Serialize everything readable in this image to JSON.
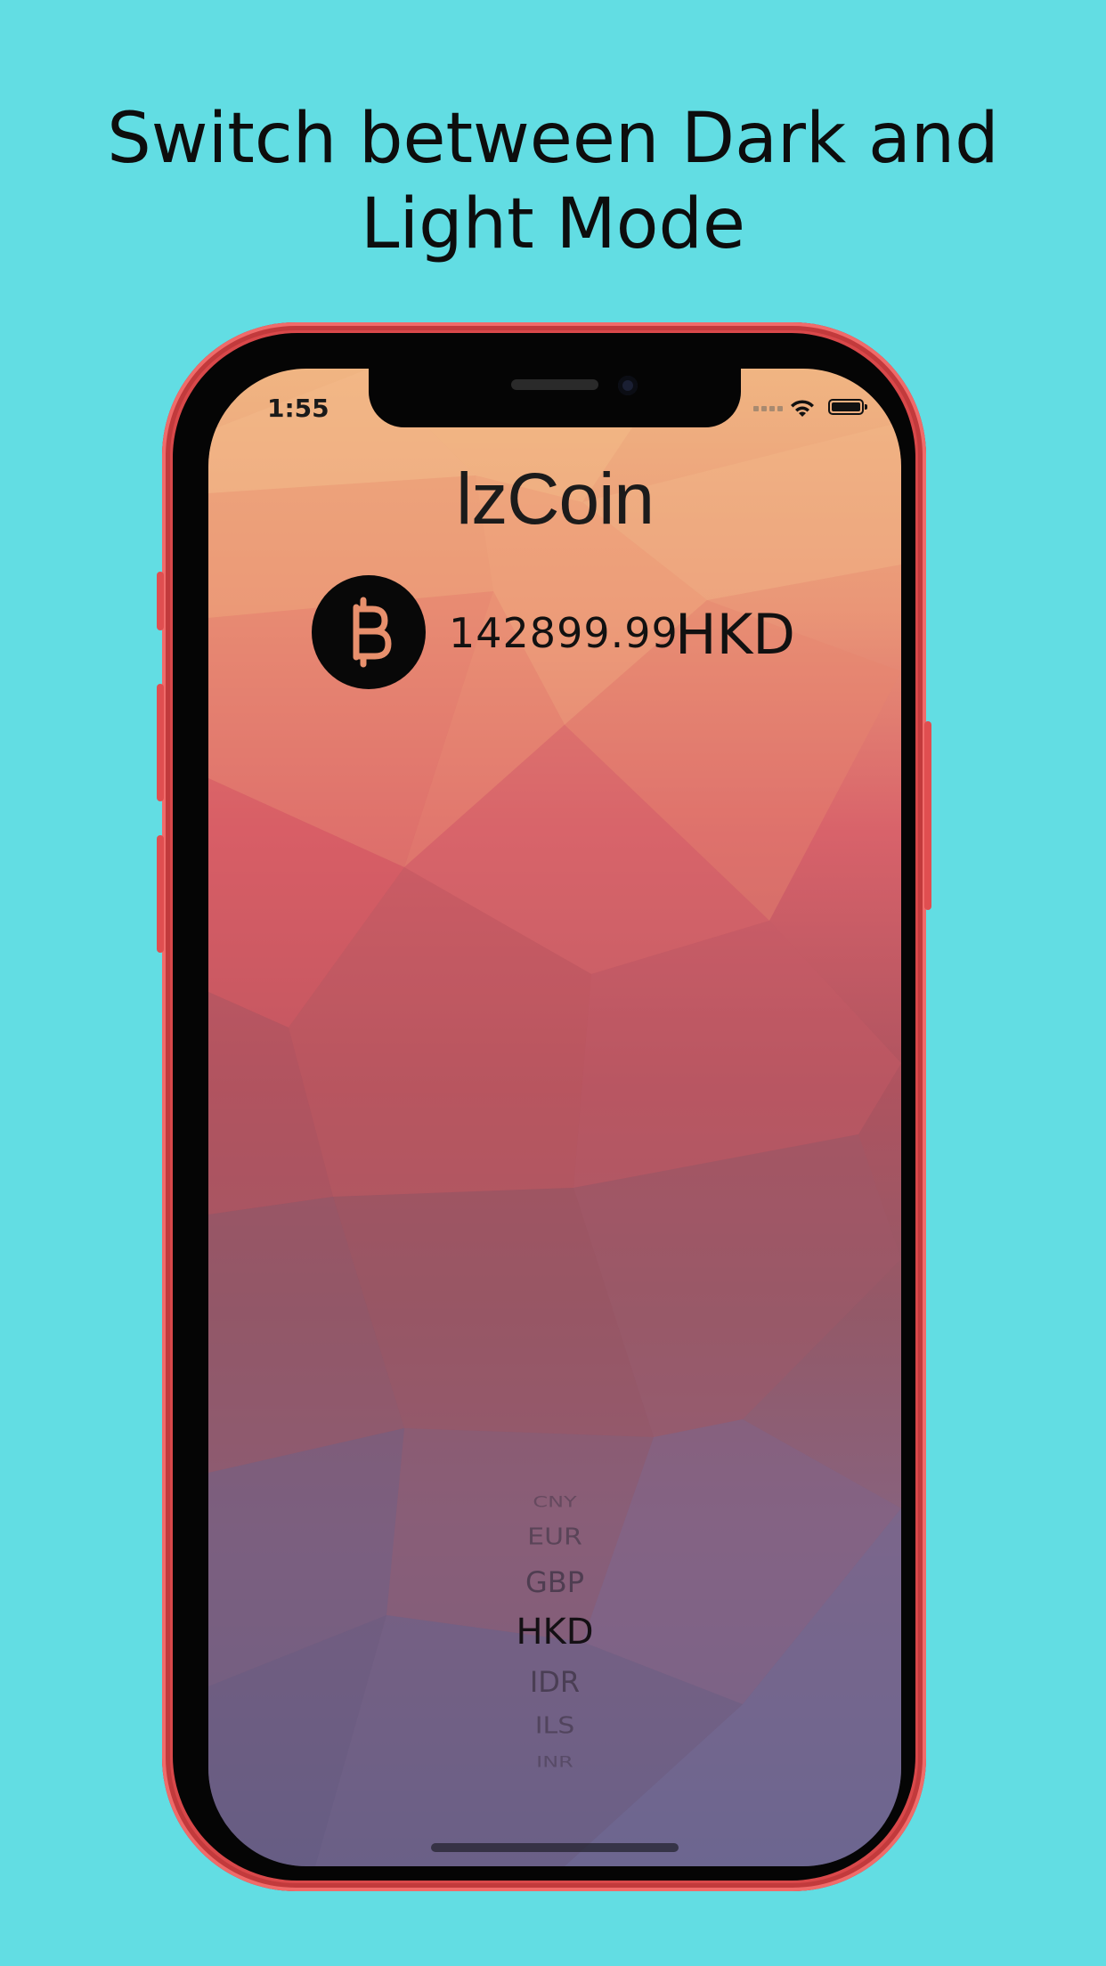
{
  "promo": {
    "headline_line1": "Switch between Dark and",
    "headline_line2": "Light Mode"
  },
  "status_bar": {
    "time": "1:55"
  },
  "app": {
    "title": "lzCoin",
    "coin_icon": "bitcoin-icon",
    "price": "142899.99",
    "selected_currency": "HKD"
  },
  "currency_picker": {
    "options": [
      "CNY",
      "EUR",
      "GBP",
      "HKD",
      "IDR",
      "ILS",
      "INR"
    ],
    "selected": "HKD"
  },
  "colors": {
    "background": "#62dde3",
    "phone_frame": "#d9484a",
    "coin_symbol": "#e8906d"
  }
}
